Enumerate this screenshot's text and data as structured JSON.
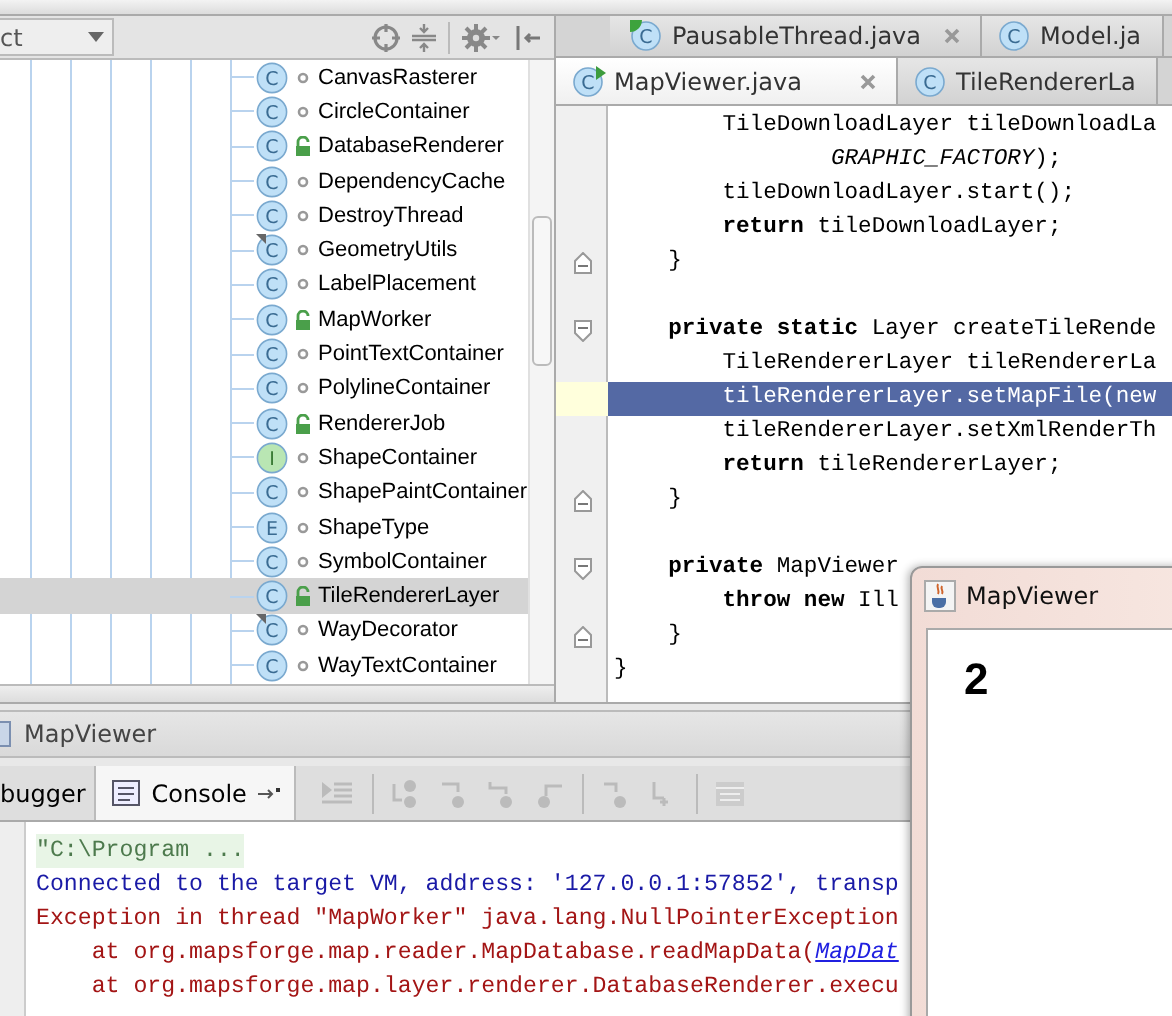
{
  "project_view": {
    "dropdown": {
      "value": "ct"
    },
    "items": [
      {
        "label": "CanvasRasterer",
        "kind": "class",
        "letter": "C",
        "public": false,
        "badge": false,
        "selected": false
      },
      {
        "label": "CircleContainer",
        "kind": "class",
        "letter": "C",
        "public": false,
        "badge": false,
        "selected": false
      },
      {
        "label": "DatabaseRenderer",
        "kind": "class",
        "letter": "C",
        "public": true,
        "badge": false,
        "selected": false
      },
      {
        "label": "DependencyCache",
        "kind": "class",
        "letter": "C",
        "public": false,
        "badge": false,
        "selected": false
      },
      {
        "label": "DestroyThread",
        "kind": "class",
        "letter": "C",
        "public": false,
        "badge": false,
        "selected": false
      },
      {
        "label": "GeometryUtils",
        "kind": "class",
        "letter": "C",
        "public": false,
        "badge": true,
        "selected": false
      },
      {
        "label": "LabelPlacement",
        "kind": "class",
        "letter": "C",
        "public": false,
        "badge": false,
        "selected": false
      },
      {
        "label": "MapWorker",
        "kind": "class",
        "letter": "C",
        "public": true,
        "badge": false,
        "selected": false
      },
      {
        "label": "PointTextContainer",
        "kind": "class",
        "letter": "C",
        "public": false,
        "badge": false,
        "selected": false
      },
      {
        "label": "PolylineContainer",
        "kind": "class",
        "letter": "C",
        "public": false,
        "badge": false,
        "selected": false
      },
      {
        "label": "RendererJob",
        "kind": "class",
        "letter": "C",
        "public": true,
        "badge": false,
        "selected": false
      },
      {
        "label": "ShapeContainer",
        "kind": "interface",
        "letter": "I",
        "public": false,
        "badge": false,
        "selected": false
      },
      {
        "label": "ShapePaintContainer",
        "kind": "class",
        "letter": "C",
        "public": false,
        "badge": false,
        "selected": false
      },
      {
        "label": "ShapeType",
        "kind": "enum",
        "letter": "E",
        "public": false,
        "badge": false,
        "selected": false
      },
      {
        "label": "SymbolContainer",
        "kind": "class",
        "letter": "C",
        "public": false,
        "badge": false,
        "selected": false
      },
      {
        "label": "TileRendererLayer",
        "kind": "class",
        "letter": "C",
        "public": true,
        "badge": false,
        "selected": true
      },
      {
        "label": "WayDecorator",
        "kind": "class",
        "letter": "C",
        "public": false,
        "badge": true,
        "selected": false
      },
      {
        "label": "WayTextContainer",
        "kind": "class",
        "letter": "C",
        "public": false,
        "badge": false,
        "selected": false
      }
    ]
  },
  "editor": {
    "tab_rows": [
      [
        {
          "label": "PausableThread.java",
          "kind": "runnable",
          "letter": "C",
          "closable": true,
          "selected": false
        },
        {
          "label": "Model.ja",
          "kind": "class",
          "letter": "C",
          "closable": false,
          "selected": false
        }
      ],
      [
        {
          "label": "MapViewer.java",
          "kind": "main",
          "letter": "C",
          "closable": true,
          "selected": true
        },
        {
          "label": "TileRendererLa",
          "kind": "class",
          "letter": "C",
          "closable": false,
          "selected": false
        }
      ]
    ],
    "lines": [
      {
        "kind": "plain",
        "highlighted": false,
        "text": "        TileDownloadLayer tileDownloadLa"
      },
      {
        "kind": "plain",
        "highlighted": false,
        "text": "                *GRAPHIC_FACTORY*);"
      },
      {
        "kind": "plain",
        "highlighted": false,
        "text": "        tileDownloadLayer.start();"
      },
      {
        "kind": "plain",
        "highlighted": false,
        "text": "        **return** tileDownloadLayer;"
      },
      {
        "kind": "fold-end",
        "highlighted": false,
        "text": "    }"
      },
      {
        "kind": "plain",
        "highlighted": false
      },
      {
        "kind": "fold-start",
        "highlighted": false,
        "text": "    **private static** Layer createTileRende"
      },
      {
        "kind": "plain",
        "highlighted": false,
        "text": "        TileRendererLayer tileRendererLa"
      },
      {
        "kind": "plain",
        "highlighted": true,
        "text": "        tileRendererLayer.setMapFile(new"
      },
      {
        "kind": "plain",
        "highlighted": false,
        "text": "        tileRendererLayer.setXmlRenderTh"
      },
      {
        "kind": "plain",
        "highlighted": false,
        "text": "        **return** tileRendererLayer;"
      },
      {
        "kind": "fold-end",
        "highlighted": false,
        "text": "    }"
      },
      {
        "kind": "plain",
        "highlighted": false
      },
      {
        "kind": "fold-start",
        "highlighted": false,
        "text": "    **private** MapViewer"
      },
      {
        "kind": "plain",
        "highlighted": false,
        "text": "        **throw new** Ill"
      },
      {
        "kind": "fold-end",
        "highlighted": false,
        "text": "    }"
      },
      {
        "kind": "plain",
        "highlighted": false,
        "text": "}"
      }
    ]
  },
  "run_panel": {
    "title": "MapViewer",
    "tabs": [
      {
        "label": "bugger",
        "selected": false
      },
      {
        "label": "Console",
        "selected": true
      }
    ],
    "console": [
      {
        "kind": "command",
        "text": "\"C:\\Program ..."
      },
      {
        "kind": "info",
        "text": "Connected to the target VM, address: '127.0.0.1:57852', transp"
      },
      {
        "kind": "error",
        "text": "Exception in thread \"MapWorker\" java.lang.NullPointerException"
      },
      {
        "kind": "error",
        "text": "    at org.mapsforge.map.reader.MapDatabase.readMapData(",
        "link": "MapDat"
      },
      {
        "kind": "error",
        "text": "    at org.mapsforge.map.layer.renderer.DatabaseRenderer.execu"
      }
    ]
  },
  "app_window": {
    "title": "MapViewer",
    "content": "2"
  }
}
